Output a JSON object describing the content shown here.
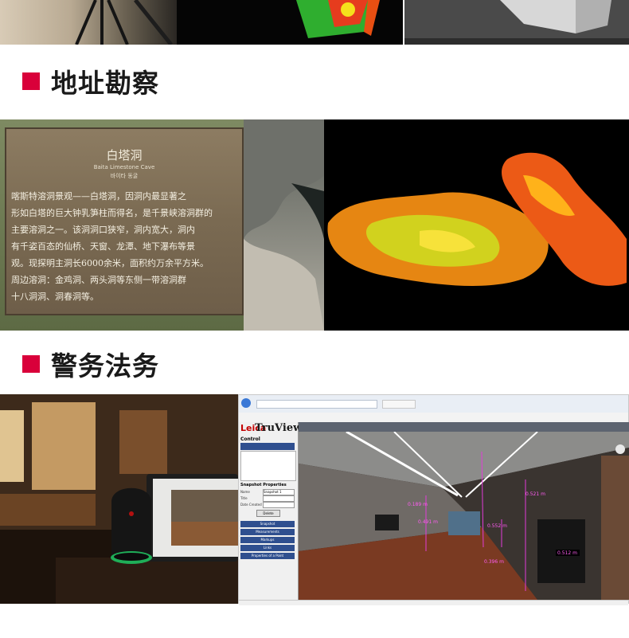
{
  "sections": {
    "site_survey": {
      "title": "地址勘察"
    },
    "police_legal": {
      "title": "警务法务"
    }
  },
  "cave_sign": {
    "title": "白塔洞",
    "subtitle_en": "Baita Limestone Cave",
    "subtitle_kr": "바이타 동굴",
    "lines": [
      "喀斯特溶洞景观——白塔洞，因洞内最显著之",
      "形如白塔的巨大钟乳笋柱而得名，是千景峡溶洞群的",
      "主要溶洞之一。该洞洞口狭窄，洞内宽大，洞内",
      "有千姿百态的仙桥、天窗、龙潭、地下瀑布等景",
      "观。现探明主洞长6000余米，面积约万余平方米。",
      "周边溶洞：金鸡洞、两头洞等东侧一带溶洞群",
      "十八洞洞、洞春洞等。"
    ]
  },
  "truview": {
    "logo": "TruView",
    "brand": "Leica",
    "control_label": "Control",
    "snapshot_label": "Snapshot Properties",
    "field_name_label": "Name",
    "field_name_value": "Snapshot 1",
    "field_title_label": "Title",
    "field_date_label": "Date Created",
    "delete_label": "Delete",
    "panels": [
      "Snapshot",
      "Measurements",
      "Markups",
      "Links",
      "Properties of a Point"
    ],
    "measurements": [
      "0.189 m",
      "0.491 m",
      "0.552 m",
      "0.512 m",
      "0.396 m",
      "0.521 m"
    ]
  },
  "colors": {
    "accent": "#d9003a"
  }
}
